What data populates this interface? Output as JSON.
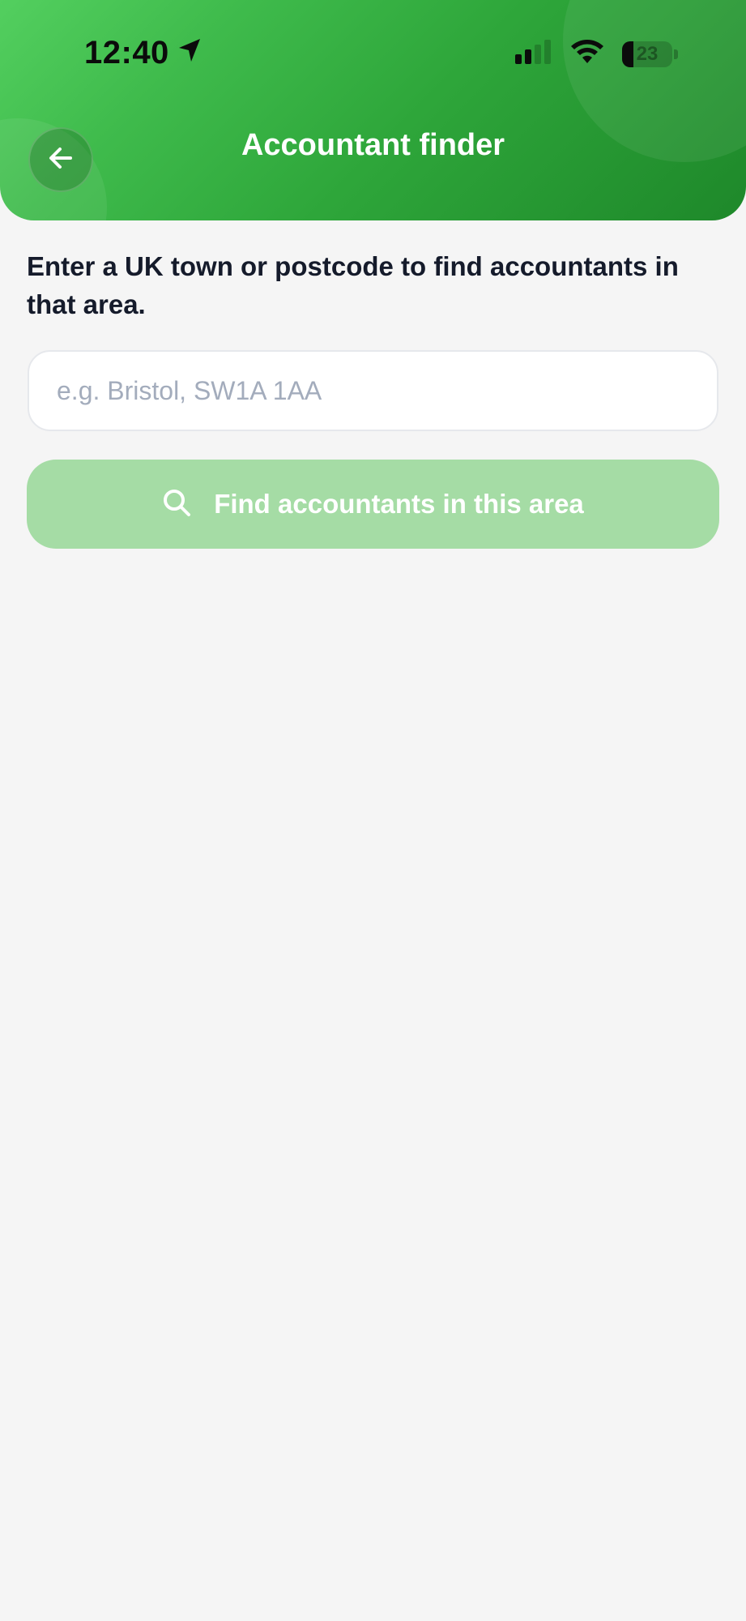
{
  "status_bar": {
    "time": "12:40",
    "battery_level": "23"
  },
  "header": {
    "title": "Accountant finder",
    "back_icon": "arrow-left-icon"
  },
  "main": {
    "instructions": "Enter a UK town or postcode to find accountants in that area.",
    "search": {
      "value": "",
      "placeholder": "e.g. Bristol, SW1A 1AA"
    },
    "find_button": {
      "label": "Find accountants in this area",
      "icon": "search-icon"
    }
  },
  "colors": {
    "header_gradient_start": "#53cf5f",
    "header_gradient_end": "#1e882a",
    "button_disabled": "#a5dca5",
    "text_primary": "#151b2b",
    "placeholder": "#a3acbc",
    "background": "#f5f5f5"
  }
}
